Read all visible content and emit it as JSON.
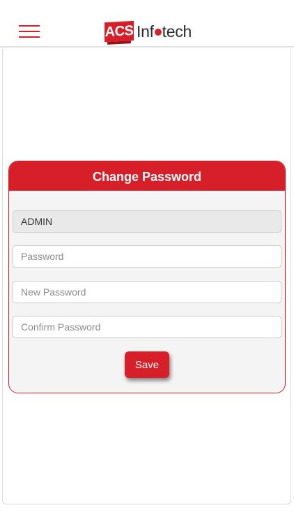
{
  "header": {
    "logo": {
      "badge": "ACS",
      "word_before": "Inf",
      "word_after": "tech"
    },
    "menu_icon": "hamburger-menu-icon"
  },
  "form": {
    "title": "Change Password",
    "username_value": "ADMIN",
    "password_placeholder": "Password",
    "new_password_placeholder": "New Password",
    "confirm_password_placeholder": "Confirm Password",
    "save_label": "Save"
  },
  "colors": {
    "brand": "#d71f2a",
    "card_bg": "#f4f4f4",
    "field_border": "#cfcfcf"
  }
}
